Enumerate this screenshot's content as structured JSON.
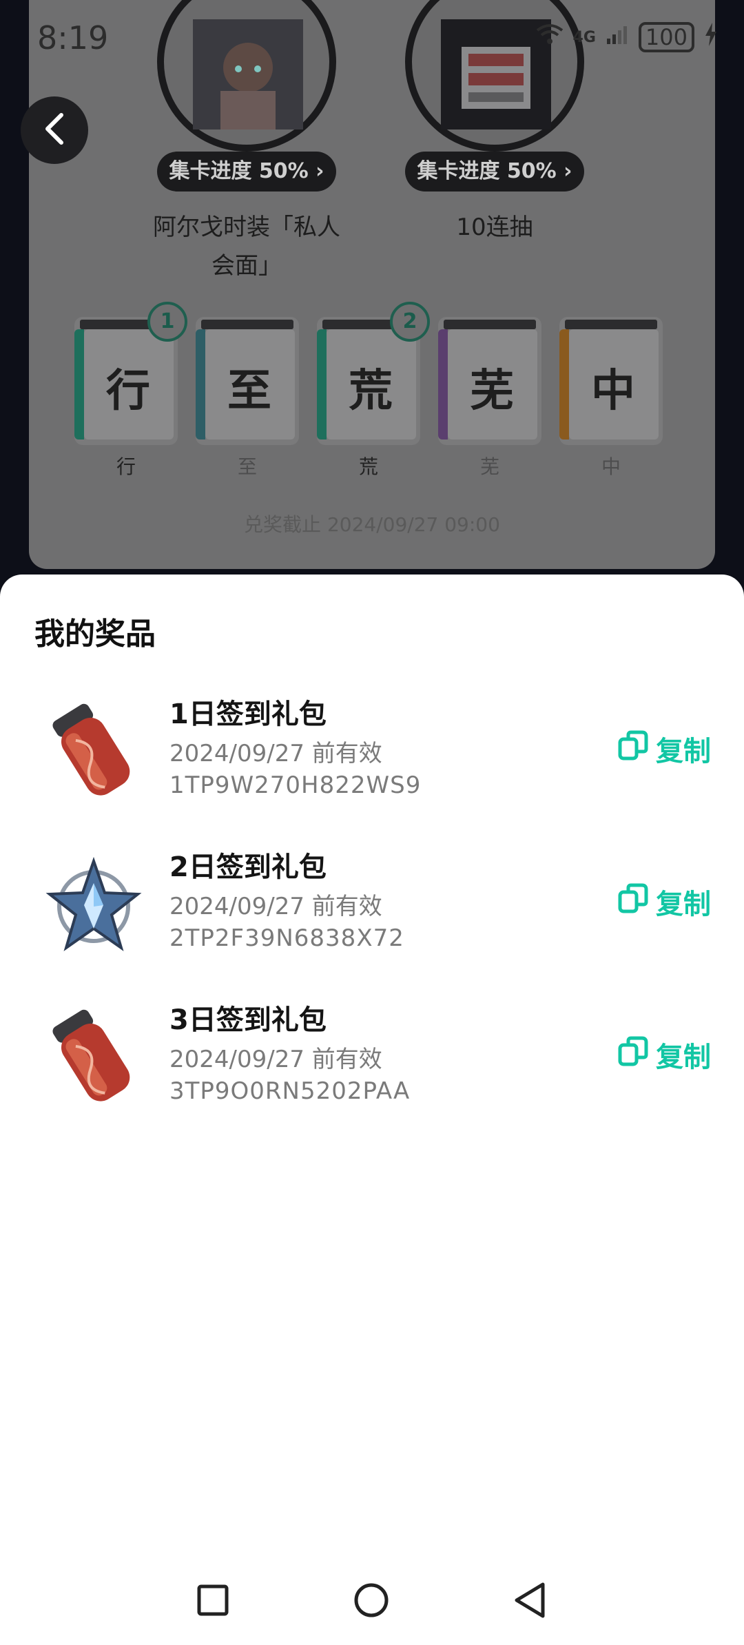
{
  "status_bar": {
    "time": "8:19",
    "network": "4G",
    "battery": "100"
  },
  "background": {
    "rewards": [
      {
        "progress": "集卡进度 50% ›",
        "label": "阿尔戈时装「私人会面」"
      },
      {
        "progress": "集卡进度 50% ›",
        "label": "10连抽"
      }
    ],
    "cards": [
      {
        "char": "行",
        "caption": "行",
        "badge": "1",
        "color": "#1e6f5c"
      },
      {
        "char": "至",
        "caption": "至",
        "badge": "",
        "color": "#2e5e66"
      },
      {
        "char": "荒",
        "caption": "荒",
        "badge": "2",
        "color": "#1e6f5c"
      },
      {
        "char": "芜",
        "caption": "芜",
        "badge": "",
        "color": "#5a3e6e"
      },
      {
        "char": "中",
        "caption": "中",
        "badge": "",
        "color": "#8a5a1e"
      }
    ],
    "deadline": "兑奖截止 2024/09/27 09:00"
  },
  "sheet": {
    "title": "我的奖品",
    "copy_label": "复制",
    "prizes": [
      {
        "name": "1日签到礼包",
        "valid": "2024/09/27 前有效",
        "code": "1TP9W270H822WS9",
        "icon": "red-capsule-icon"
      },
      {
        "name": "2日签到礼包",
        "valid": "2024/09/27 前有效",
        "code": "2TP2F39N6838X72",
        "icon": "blue-star-crystal-icon"
      },
      {
        "name": "3日签到礼包",
        "valid": "2024/09/27 前有效",
        "code": "3TP9O0RN5202PAA",
        "icon": "red-capsule-icon"
      }
    ]
  },
  "colors": {
    "accent": "#12c6a4",
    "sheet_bg": "#ffffff",
    "overlay": "#6f6f70"
  }
}
